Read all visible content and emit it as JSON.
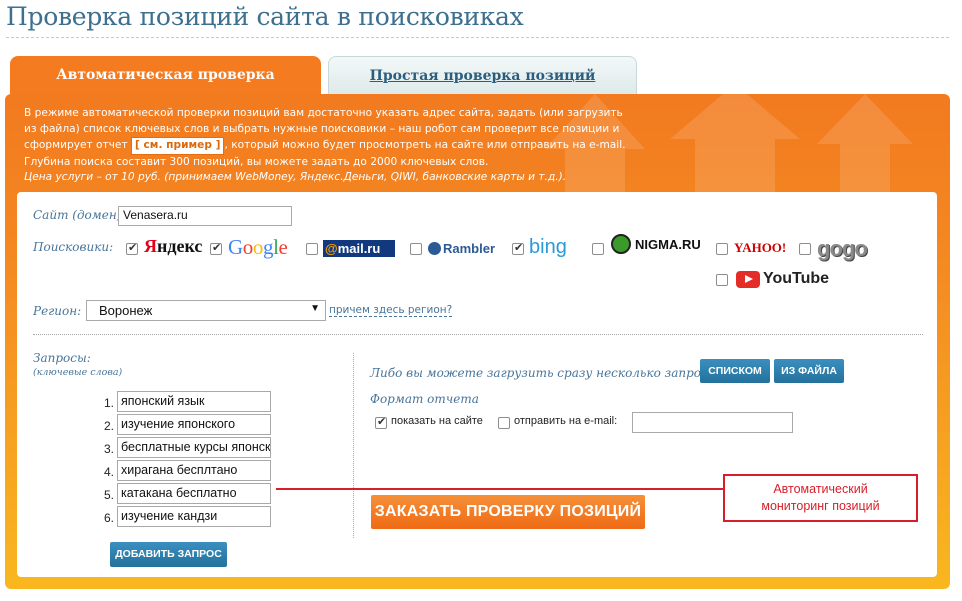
{
  "page": {
    "title": "Проверка позиций сайта в поисковиках"
  },
  "tabs": {
    "auto": "Автоматическая проверка",
    "simple": "Простая проверка позиций"
  },
  "intro": {
    "line1": "В режиме автоматической проверки позиций вам достаточно указать адрес сайта, задать (или загрузить",
    "line2": "из файла) список ключевых слов и выбрать нужные поисковики – наш робот сам проверит все позиции и",
    "line3_a": "сформирует отчет ",
    "example_link": "[ см. пример ]",
    "line3_b": ", который можно будет просмотреть на сайте или отправить на e-mail.",
    "line4": "Глубина поиска составит 300 позиций, вы можете задать до 2000 ключевых слов.",
    "price": "Цена услуги – от 10 руб. (принимаем WebMoney, Яндекс.Деньги, QIWI, банковские карты и т.д.)."
  },
  "form": {
    "site_label": "Сайт (домен):",
    "site_value": "Venasera.ru",
    "engines_label": "Поисковики:",
    "engines": [
      {
        "name": "Яндекс",
        "checked": true,
        "icon": "yandex-logo"
      },
      {
        "name": "Google",
        "checked": true,
        "icon": "google-logo"
      },
      {
        "name": "@mail.ru",
        "checked": false,
        "icon": "mailru-logo"
      },
      {
        "name": "Rambler",
        "checked": false,
        "icon": "rambler-logo"
      },
      {
        "name": "bing",
        "checked": true,
        "icon": "bing-logo"
      },
      {
        "name": "NIGMA.RU",
        "checked": false,
        "icon": "nigma-logo"
      },
      {
        "name": "YAHOO!",
        "checked": false,
        "icon": "yahoo-logo"
      },
      {
        "name": "gogo",
        "checked": false,
        "icon": "gogo-logo"
      },
      {
        "name": "YouTube",
        "checked": false,
        "icon": "youtube-logo"
      }
    ],
    "region_label": "Регион:",
    "region_value": "Воронеж",
    "region_link": "причем здесь регион?",
    "queries_label": "Запросы:",
    "queries_sub": "(ключевые слова)",
    "queries": [
      {
        "num": "1.",
        "text": "японский язык"
      },
      {
        "num": "2.",
        "text": "изучение японского"
      },
      {
        "num": "3.",
        "text": "бесплатные курсы японского"
      },
      {
        "num": "4.",
        "text": "хирагана бесплтано"
      },
      {
        "num": "5.",
        "text": "катакана бесплатно"
      },
      {
        "num": "6.",
        "text": "изучение кандзи"
      }
    ],
    "add_button": "ДОБАВИТЬ ЗАПРОС",
    "bulk_label": "Либо вы можете загрузить сразу несколько запросов:",
    "list_button": "СПИСКОМ",
    "file_button": "ИЗ ФАЙЛА",
    "format_label": "Формат отчета",
    "show_on_site": "показать на сайте",
    "show_on_site_checked": true,
    "send_email": "отправить на e-mail:",
    "send_email_checked": false,
    "email_value": "",
    "order_button": "ЗАКАЗАТЬ ПРОВЕРКУ ПОЗИЦИЙ"
  },
  "annotation": {
    "line1": "Автоматический",
    "line2": "мониторинг позиций",
    "color": "#d81e2a"
  },
  "colors": {
    "orange": "#f47b20",
    "blue_text": "#49759a",
    "title": "#3d6f8e"
  }
}
